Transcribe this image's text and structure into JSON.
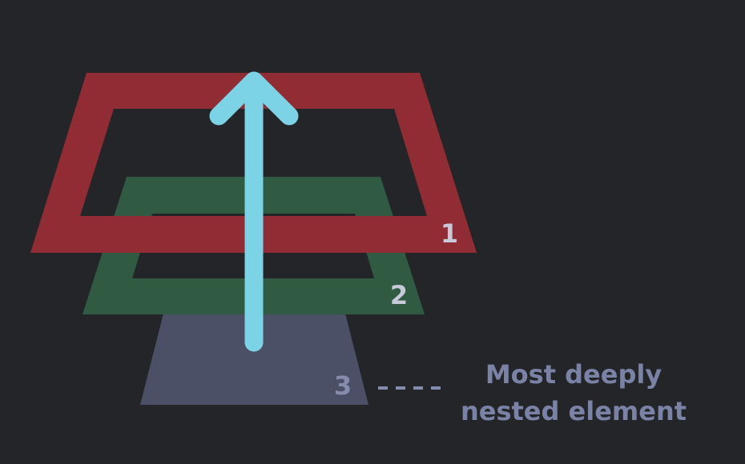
{
  "colors": {
    "background": "#242528",
    "layer_1": "#912c35",
    "layer_2": "#315a43",
    "layer_3": "#4c5066",
    "arrow": "#7dd3e6",
    "layer_label": "#c6cad9",
    "layer_3_label": "#858cae",
    "caption": "#7a82a6",
    "dash": "#858cae"
  },
  "layers": [
    {
      "label": "1"
    },
    {
      "label": "2"
    },
    {
      "label": "3"
    }
  ],
  "caption": {
    "line_1": "Most deeply",
    "line_2": "nested element"
  },
  "arrow_direction": "up"
}
